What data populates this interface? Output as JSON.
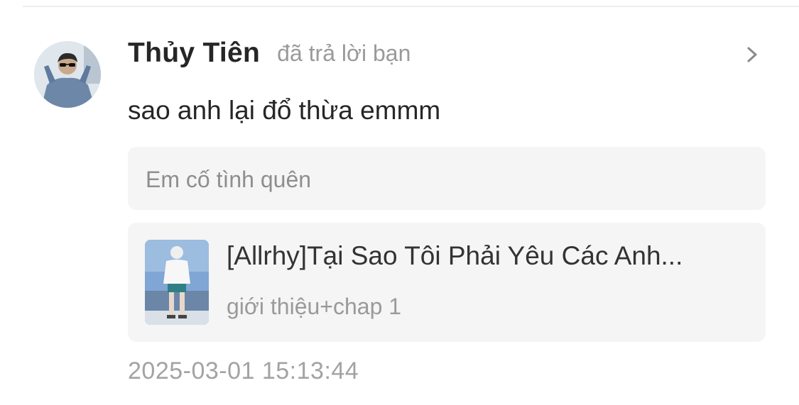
{
  "notification": {
    "username": "Thủy Tiên",
    "action_text": "đã trả lời bạn",
    "reply_text": "sao anh lại đổ thừa emmm",
    "quoted_comment": "Em cố tình quên",
    "timestamp": "2025-03-01 15:13:44",
    "avatar_icon": "user-avatar-photo",
    "chevron_icon": "chevron-right-icon"
  },
  "story": {
    "title": "[Allrhy]Tại Sao Tôi Phải Yêu Các Anh...",
    "chapter": "giới thiệu+chap 1",
    "cover_icon": "story-cover-image"
  },
  "colors": {
    "username": "#262626",
    "secondary_text": "#9a9a9a",
    "card_background": "#f5f5f5",
    "timestamp": "#a3a3a3"
  }
}
